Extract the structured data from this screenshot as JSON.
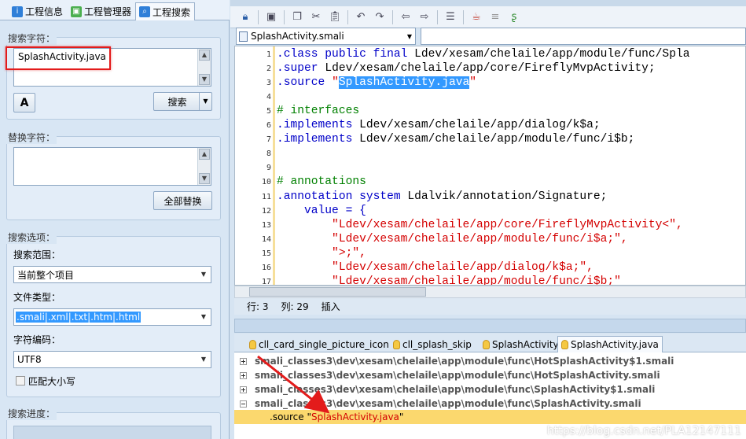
{
  "left_tabs": [
    {
      "label": "工程信息",
      "icon": "info-icon",
      "color": "#2f7fd8"
    },
    {
      "label": "工程管理器",
      "icon": "android-icon",
      "color": "#4caf50"
    },
    {
      "label": "工程搜索",
      "icon": "search-icon",
      "color": "#2f7fd8"
    }
  ],
  "search": {
    "group_title": "搜索字符：",
    "value": "SplashActivity.java",
    "font_button": "A",
    "search_button": "搜索"
  },
  "replace": {
    "group_title": "替换字符：",
    "value": "",
    "replace_all_button": "全部替换"
  },
  "options": {
    "group_title": "搜索选项：",
    "scope_label": "搜索范围：",
    "scope_value": "当前整个项目",
    "filetype_label": "文件类型：",
    "filetype_value": ".smali|.xml|.txt|.htm|.html",
    "encoding_label": "字符编码：",
    "encoding_value": "UTF8",
    "match_case_label": "匹配大小写"
  },
  "progress": {
    "group_title": "搜索进度："
  },
  "editor": {
    "file": "SplashActivity.smali",
    "lines": [
      {
        "n": "1",
        "parts": [
          {
            "t": ".class public final ",
            "c": "kw"
          },
          {
            "t": "Ldev/xesam/chelaile/app/module/func/Spla",
            "c": ""
          }
        ]
      },
      {
        "n": "2",
        "parts": [
          {
            "t": ".super ",
            "c": "kw"
          },
          {
            "t": "Ldev/xesam/chelaile/app/core/FireflyMvpActivity;",
            "c": ""
          }
        ]
      },
      {
        "n": "3",
        "parts": [
          {
            "t": ".source ",
            "c": "kw"
          },
          {
            "t": "\"",
            "c": "str"
          },
          {
            "t": "SplashActivity.java",
            "c": "hl"
          },
          {
            "t": "\"",
            "c": "str"
          }
        ]
      },
      {
        "n": "4",
        "parts": []
      },
      {
        "n": "5",
        "parts": [
          {
            "t": "# interfaces",
            "c": "cmt"
          }
        ]
      },
      {
        "n": "6",
        "parts": [
          {
            "t": ".implements ",
            "c": "kw"
          },
          {
            "t": "Ldev/xesam/chelaile/app/dialog/k$a;",
            "c": ""
          }
        ]
      },
      {
        "n": "7",
        "parts": [
          {
            "t": ".implements ",
            "c": "kw"
          },
          {
            "t": "Ldev/xesam/chelaile/app/module/func/i$b;",
            "c": ""
          }
        ]
      },
      {
        "n": "8",
        "parts": []
      },
      {
        "n": "9",
        "parts": []
      },
      {
        "n": "10",
        "parts": [
          {
            "t": "# annotations",
            "c": "cmt"
          }
        ]
      },
      {
        "n": "11",
        "parts": [
          {
            "t": ".annotation system ",
            "c": "kw"
          },
          {
            "t": "Ldalvik/annotation/Signature;",
            "c": ""
          }
        ]
      },
      {
        "n": "12",
        "parts": [
          {
            "t": "    value = {",
            "c": "kw"
          }
        ]
      },
      {
        "n": "13",
        "parts": [
          {
            "t": "        \"Ldev/xesam/chelaile/app/core/FireflyMvpActivity<\",",
            "c": "str"
          }
        ]
      },
      {
        "n": "14",
        "parts": [
          {
            "t": "        \"Ldev/xesam/chelaile/app/module/func/i$a;\",",
            "c": "str"
          }
        ]
      },
      {
        "n": "15",
        "parts": [
          {
            "t": "        \">;\",",
            "c": "str"
          }
        ]
      },
      {
        "n": "16",
        "parts": [
          {
            "t": "        \"Ldev/xesam/chelaile/app/dialog/k$a;\",",
            "c": "str"
          }
        ]
      },
      {
        "n": "17",
        "parts": [
          {
            "t": "        \"Ldev/xesam/chelaile/app/module/func/i$b;\"",
            "c": "str"
          }
        ]
      }
    ]
  },
  "status": {
    "row": "行: 3",
    "col": "列: 29",
    "mode": "插入"
  },
  "result_tabs": [
    {
      "label": "cll_card_single_picture_icon"
    },
    {
      "label": "cll_splash_skip"
    },
    {
      "label": "SplashActivity"
    },
    {
      "label": "SplashActivity.java",
      "active": true
    }
  ],
  "results": [
    {
      "text": "smali_classes3\\dev\\xesam\\chelaile\\app\\module\\func\\HotSplashActivity$1.smali",
      "expanded": false
    },
    {
      "text": "smali_classes3\\dev\\xesam\\chelaile\\app\\module\\func\\HotSplashActivity.smali",
      "expanded": false
    },
    {
      "text": "smali_classes3\\dev\\xesam\\chelaile\\app\\module\\func\\SplashActivity$1.smali",
      "expanded": false
    },
    {
      "text": "smali_classes3\\dev\\xesam\\chelaile\\app\\module\\func\\SplashActivity.smali",
      "expanded": true
    }
  ],
  "match": {
    "prefix": ".source \"",
    "hit": "SplashActivity.java",
    "suffix": "\""
  },
  "watermark": "https://blog.csdn.net/PLA12147111",
  "colors": {
    "highlight": "#3399ff",
    "annotation": "#e31b1b",
    "selected_row": "#fbd86e"
  }
}
